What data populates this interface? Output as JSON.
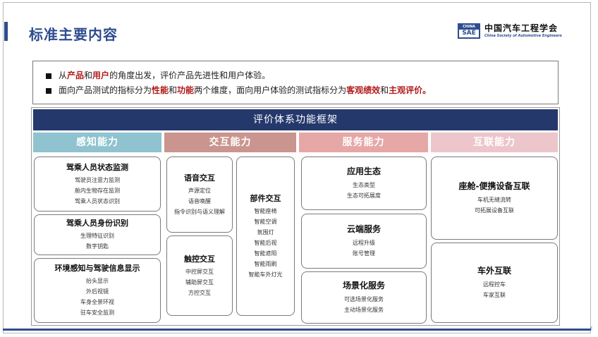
{
  "header": {
    "title": "标准主要内容",
    "logo": {
      "mark_top": "CHINA",
      "mark_bottom": "SAE",
      "cn": "中国汽车工程学会",
      "en": "China Society of Automotive Engineers"
    }
  },
  "intro": {
    "line1": {
      "a": "从",
      "b": "产品",
      "c": "和",
      "d": "用户",
      "e": "的角度出发，评价产品先进性和用户体验。"
    },
    "line2": {
      "a": "面向产品测试的指标分为",
      "b": "性能",
      "c": "和",
      "d": "功能",
      "e": "两个维度，面向用户体验的测试指标分为",
      "f": "客观绩效",
      "g": "和",
      "h": "主观评价。"
    }
  },
  "framework": {
    "title": "评价体系功能框架",
    "categories": [
      {
        "label": "感知能力",
        "color": "#8fc3cf"
      },
      {
        "label": "交互能力",
        "color": "#c9958e"
      },
      {
        "label": "服务能力",
        "color": "#e6a7a7"
      },
      {
        "label": "互联能力",
        "color": "#ecc6cb"
      }
    ],
    "perception": [
      {
        "title": "驾乘人员状态监测",
        "items": [
          "驾驶员注意力监测",
          "舱内生物存在监测",
          "驾乘人员状态识别"
        ]
      },
      {
        "title": "驾乘人员身份识别",
        "items": [
          "生理特征识别",
          "数字钥匙"
        ]
      },
      {
        "title": "环境感知与驾驶信息显示",
        "items": [
          "抬头显示",
          "外后视镜",
          "车身全景环视",
          "驻车安全监测"
        ]
      }
    ],
    "interaction": {
      "voice": {
        "title": "语音交互",
        "items": [
          "声源定位",
          "语音唤醒",
          "指令识别与语义理解"
        ]
      },
      "touch": {
        "title": "触控交互",
        "items": [
          "中控屏交互",
          "辅助屏交互",
          "方控交互"
        ]
      },
      "parts": {
        "title": "部件交互",
        "items": [
          "智能座椅",
          "智能空调",
          "氛围灯",
          "智能后视",
          "智能遮阳",
          "智能雨刷",
          "智能车外灯光"
        ]
      }
    },
    "service": [
      {
        "title": "应用生态",
        "items": [
          "生态类型",
          "生态可拓展度"
        ]
      },
      {
        "title": "云端服务",
        "items": [
          "远程升级",
          "账号管理"
        ]
      },
      {
        "title": "场景化服务",
        "items": [
          "可选场景化服务",
          "主动场景化服务"
        ]
      }
    ],
    "connectivity": [
      {
        "title": "座舱-便携设备互联",
        "items": [
          "车机无缝流转",
          "可拓展设备互联"
        ]
      },
      {
        "title": "车外互联",
        "items": [
          "远程控车",
          "车家互联"
        ]
      }
    ]
  }
}
